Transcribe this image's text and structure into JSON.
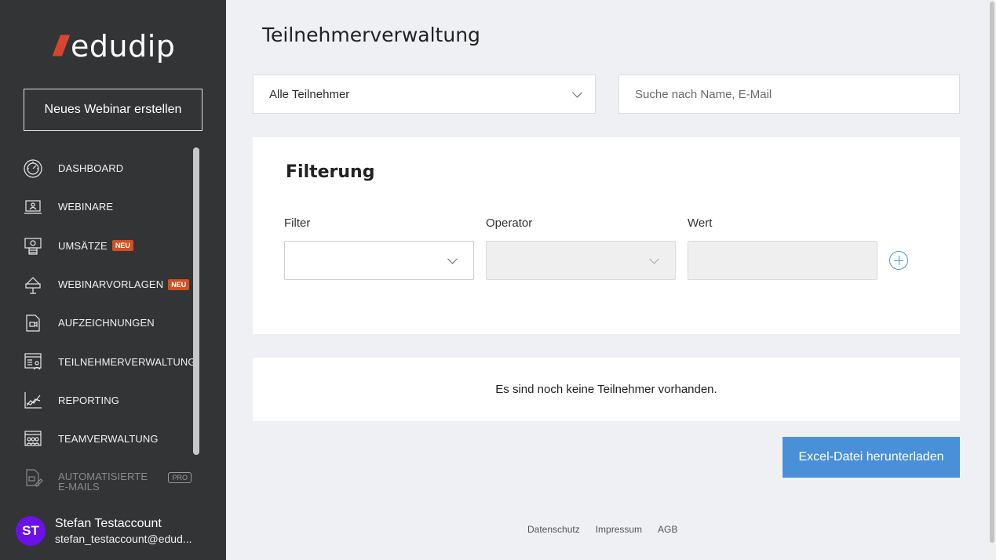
{
  "sidebar": {
    "brand": {
      "slashes": "///",
      "name": "edudip"
    },
    "new_webinar_label": "Neues Webinar erstellen",
    "items": [
      {
        "label": "DASHBOARD",
        "icon": "dashboard-gauge-icon"
      },
      {
        "label": "WEBINARE",
        "icon": "webinar-laptop-icon"
      },
      {
        "label": "UMSÄTZE",
        "icon": "revenue-money-icon",
        "badge": "NEU"
      },
      {
        "label": "WEBINARVORLAGEN",
        "icon": "template-stage-icon",
        "badge": "NEU"
      },
      {
        "label": "AUFZEICHNUNGEN",
        "icon": "recording-file-icon"
      },
      {
        "label": "TEILNEHMERVERWALTUNG",
        "icon": "participants-list-icon"
      },
      {
        "label": "REPORTING",
        "icon": "reporting-chart-icon"
      },
      {
        "label": "TEAMVERWALTUNG",
        "icon": "team-icon"
      },
      {
        "label": "AUTOMATISIERTE E-MAILS",
        "icon": "automated-email-icon",
        "badge": "PRO"
      }
    ],
    "user": {
      "initials": "ST",
      "name": "Stefan Testaccount",
      "email": "stefan_testaccount@edud..."
    }
  },
  "main": {
    "title": "Teilnehmerverwaltung",
    "participant_select": {
      "value": "Alle Teilnehmer"
    },
    "search": {
      "placeholder": "Suche nach Name, E-Mail"
    },
    "filter": {
      "title": "Filterung",
      "col_filter": "Filter",
      "col_operator": "Operator",
      "col_value": "Wert"
    },
    "empty_message": "Es sind noch keine Teilnehmer vorhanden.",
    "excel_button": "Excel-Datei herunterladen",
    "footer": {
      "privacy": "Datenschutz",
      "imprint": "Impressum",
      "terms": "AGB"
    }
  },
  "colors": {
    "sidebar_bg": "#323436",
    "accent_blue": "#4a90d9",
    "badge_orange": "#d24f22",
    "avatar_purple": "#6a12e8",
    "page_bg": "#eff0f3"
  }
}
